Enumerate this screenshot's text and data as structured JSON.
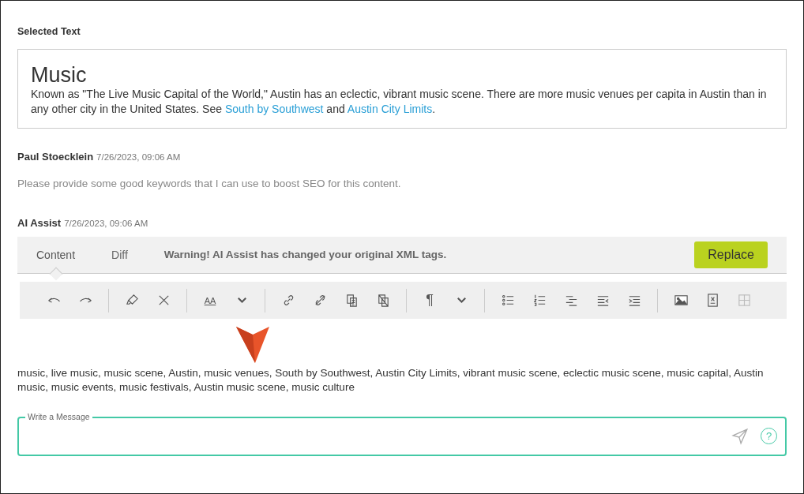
{
  "selected_text": {
    "label": "Selected Text",
    "heading": "Music",
    "body": "Known as \"The Live Music Capital of the World,\" Austin has an eclectic, vibrant music scene. There are more music venues per capita in Austin than in any other city in the United States. See ",
    "links": [
      {
        "text": "South by Southwest"
      },
      {
        "text": "Austin City Limits"
      }
    ],
    "joiner": " and ",
    "end": "."
  },
  "messages": [
    {
      "author": "Paul Stoecklein",
      "time": "7/26/2023, 09:06 AM",
      "text": "Please provide some good keywords that I can use to boost SEO for this content."
    },
    {
      "author": "AI Assist",
      "time": "7/26/2023, 09:06 AM"
    }
  ],
  "tabs": [
    {
      "label": "Content",
      "selected": true
    },
    {
      "label": "Diff",
      "selected": false
    }
  ],
  "warning": "Warning! AI Assist has changed your original XML tags.",
  "replace_button": "Replace",
  "toolbar": [
    [
      {
        "kind": "undo",
        "disabled": false
      },
      {
        "kind": "redo",
        "disabled": false
      }
    ],
    [
      {
        "kind": "highlighter",
        "disabled": false
      },
      {
        "kind": "clear",
        "disabled": false
      }
    ],
    [
      {
        "kind": "text",
        "text": "AA",
        "disabled": false
      },
      {
        "kind": "caret",
        "disabled": false
      }
    ],
    [
      {
        "kind": "link",
        "disabled": false
      },
      {
        "kind": "unlink",
        "disabled": false
      },
      {
        "kind": "paste",
        "disabled": false
      },
      {
        "kind": "paste-x",
        "disabled": false
      }
    ],
    [
      {
        "kind": "text",
        "text": "¶",
        "disabled": false
      },
      {
        "kind": "caret",
        "disabled": false
      }
    ],
    [
      {
        "kind": "bullets",
        "disabled": false
      },
      {
        "kind": "numbered",
        "disabled": false
      },
      {
        "kind": "align",
        "disabled": false
      },
      {
        "kind": "outdent",
        "disabled": false
      },
      {
        "kind": "indent",
        "disabled": false
      }
    ],
    [
      {
        "kind": "image",
        "disabled": false
      },
      {
        "kind": "formula",
        "disabled": false
      },
      {
        "kind": "table",
        "disabled": true
      }
    ]
  ],
  "result": "music, live music, music scene, Austin, music venues, South by Southwest, Austin City Limits, vibrant music scene, eclectic music scene, music capital, Austin music, music events, music festivals, Austin music scene, music culture",
  "message_field": {
    "label": "Write a Message",
    "help": "?"
  }
}
